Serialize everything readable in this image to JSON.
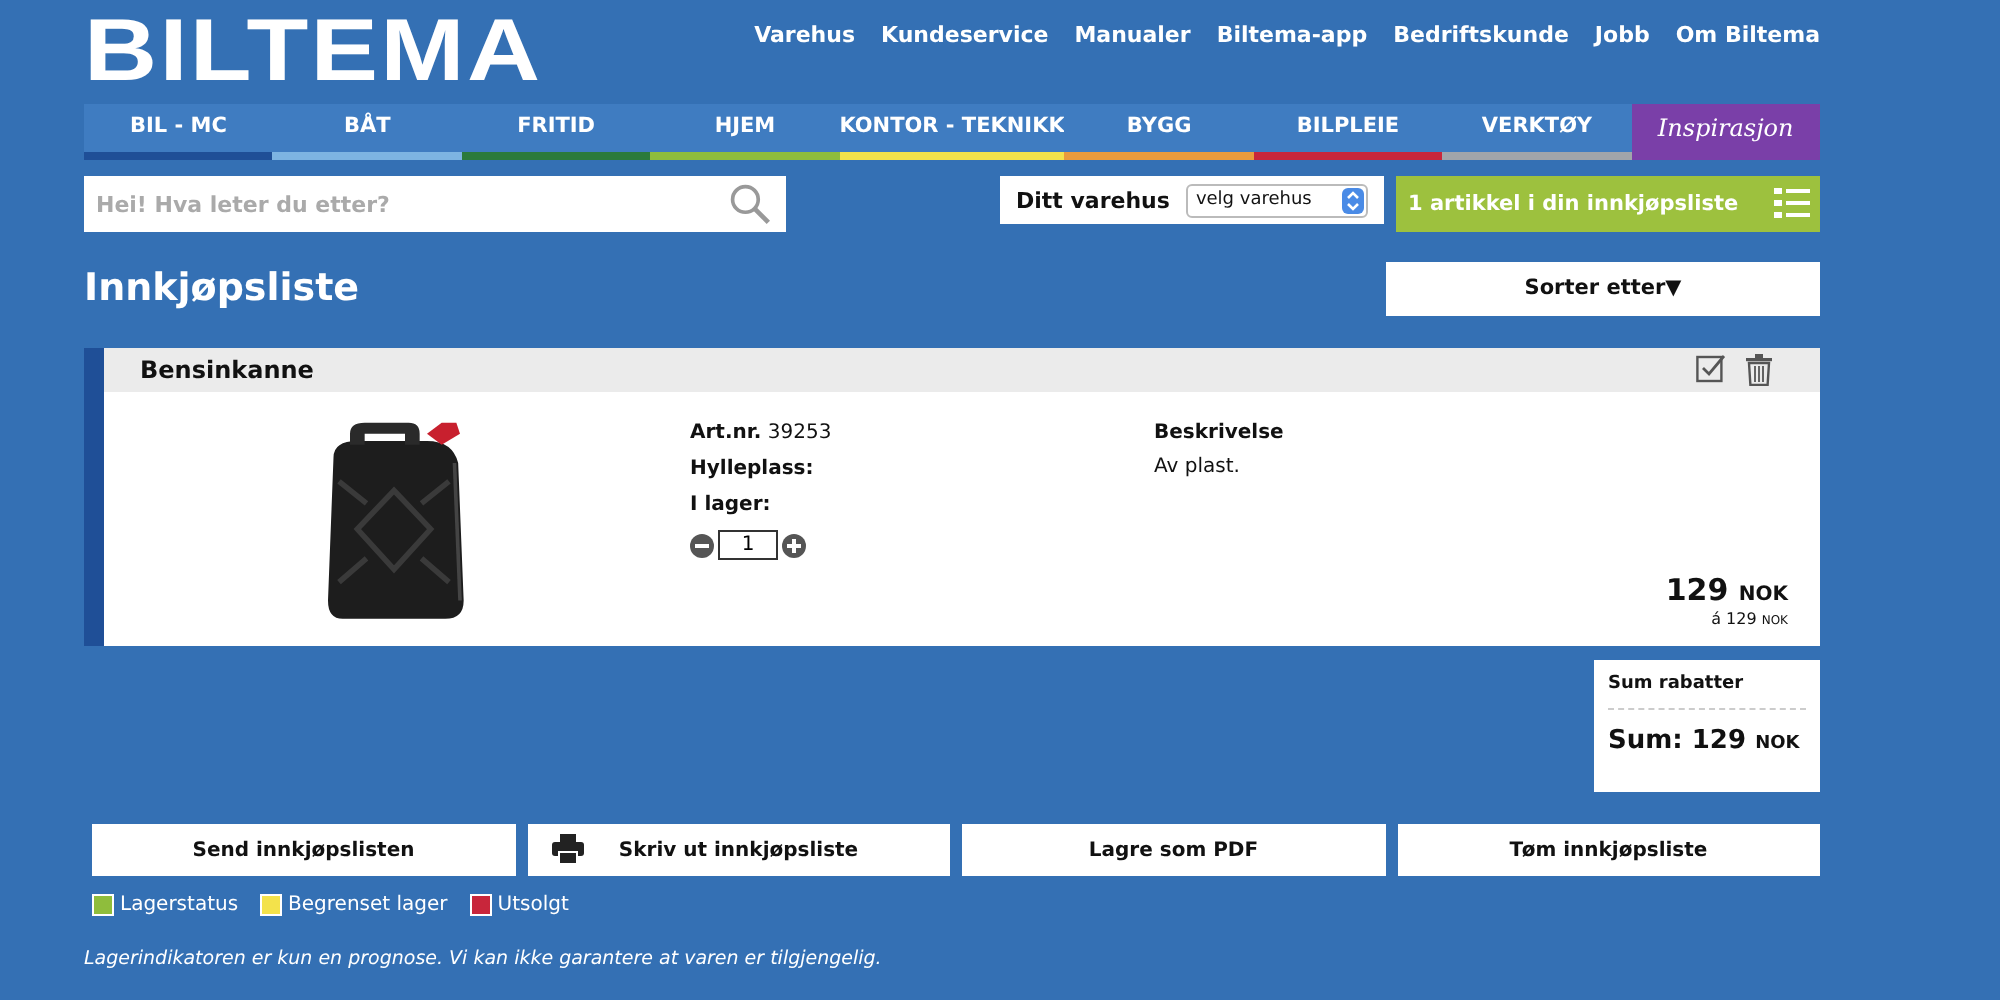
{
  "logo": "BILTEMA",
  "top_links": [
    "Varehus",
    "Kundeservice",
    "Manualer",
    "Biltema-app",
    "Bedriftskunde",
    "Jobb",
    "Om Biltema"
  ],
  "nav": [
    {
      "label": "BIL - MC",
      "kind": "category",
      "color": "#1f4f97"
    },
    {
      "label": "BÅT",
      "kind": "category",
      "color": "#7db4e2"
    },
    {
      "label": "FRITID",
      "kind": "category",
      "color": "#2b7a3b"
    },
    {
      "label": "HJEM",
      "kind": "category",
      "color": "#8fbd3c"
    },
    {
      "label": "KONTOR - TEKNIKK",
      "kind": "category",
      "color": "#f3e24b"
    },
    {
      "label": "BYGG",
      "kind": "category",
      "color": "#e99b3d"
    },
    {
      "label": "BILPLEIE",
      "kind": "category",
      "color": "#c8263b"
    },
    {
      "label": "VERKTØY",
      "kind": "category",
      "color": "#a1a5aa"
    },
    {
      "label": "Inspirasjon",
      "kind": "special",
      "color": "#7a3fa8"
    }
  ],
  "search": {
    "placeholder": "Hei! Hva leter du etter?"
  },
  "store_select": {
    "label": "Ditt varehus",
    "value": "velg varehus"
  },
  "list_badge": "1 artikkel i din innkjøpsliste",
  "page_title": "Innkjøpsliste",
  "sort_button": "Sorter etter▼",
  "items": [
    {
      "name": "Bensinkanne",
      "art_label": "Art.nr.",
      "art_nr": "39253",
      "shelf_label": "Hylleplass:",
      "stock_label": "I lager:",
      "quantity": "1",
      "description_label": "Beskrivelse",
      "description": "Av plast.",
      "price": "129",
      "currency": "NOK",
      "unit_price": "á 129",
      "unit_currency": "NOK"
    }
  ],
  "summary": {
    "discounts_label": "Sum rabatter",
    "sum": "Sum: 129",
    "currency": "NOK"
  },
  "actions": [
    {
      "label": "Send innkjøpslisten",
      "kind": "plain"
    },
    {
      "label": "Skriv ut innkjøpsliste",
      "kind": "print"
    },
    {
      "label": "Lagre som PDF",
      "kind": "plain"
    },
    {
      "label": "Tøm innkjøpsliste",
      "kind": "plain"
    }
  ],
  "legend": [
    {
      "label": "Lagerstatus",
      "color": "#8fbd3c"
    },
    {
      "label": "Begrenset lager",
      "color": "#f3e24b"
    },
    {
      "label": "Utsolgt",
      "color": "#c8263b"
    }
  ],
  "footnote": "Lagerindikatoren er kun en prognose. Vi kan ikke garantere at varen er tilgjengelig."
}
